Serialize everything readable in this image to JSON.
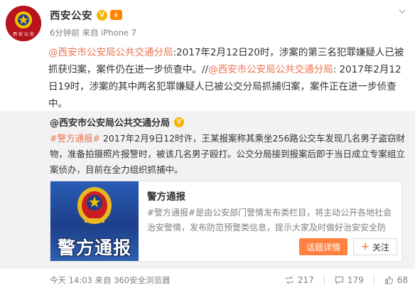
{
  "author": {
    "name": "西安公安",
    "verified_mark": "V",
    "level_mark": "6",
    "avatar_text": "西 安 公 安",
    "meta": "6分钟前 来自 iPhone 7"
  },
  "main_text": {
    "mention_1": "@西安市公安局公共交通分局",
    "text_1": ":2017年2月12日20时，涉案的第三名犯罪嫌疑人已被抓获归案，案件仍在进一步侦查中。//",
    "mention_2": "@西安市公安局公共交通分局",
    "text_2": ": 2017年2月12日19时，涉案的其中两名犯罪嫌疑人已被公交分局抓捕归案，案件正在进一步侦查中。"
  },
  "repost": {
    "author": "@西安市公安局公共交通分局",
    "verified_mark": "V",
    "tag": "#警方通报#",
    "text": " 2017年2月9日12时许，王某报案称其乘坐256路公交车发现几名男子盗窃财物，准备拍摄照片报警时，被该几名男子殴打。公交分局接到报案后即于当日成立专案组立案侦办，目前在全力组织抓捕中。",
    "card": {
      "image_text": "警方通报",
      "title": "警方通报",
      "tag": "#警方通报#",
      "desc": "是由公安部门警情发布类栏目，将主动公开各地社会治安警情，发布防范预警类信息，提示大家及时做好治安安全防",
      "primary_button": "话题详情",
      "follow_button": "关注"
    },
    "footer": {
      "time": "今天 14:03 来自 360安全浏览器",
      "repost_count": "217",
      "comment_count": "179",
      "like_count": "68"
    }
  },
  "colors": {
    "link": "#eb7350",
    "button_orange": "#ff8140",
    "verified_gold": "#f6b400",
    "repost_bg": "#f2f2f5"
  },
  "icons": [
    "police-badge-avatar",
    "chevron-down-icon",
    "repost-icon",
    "comment-icon",
    "like-icon"
  ]
}
